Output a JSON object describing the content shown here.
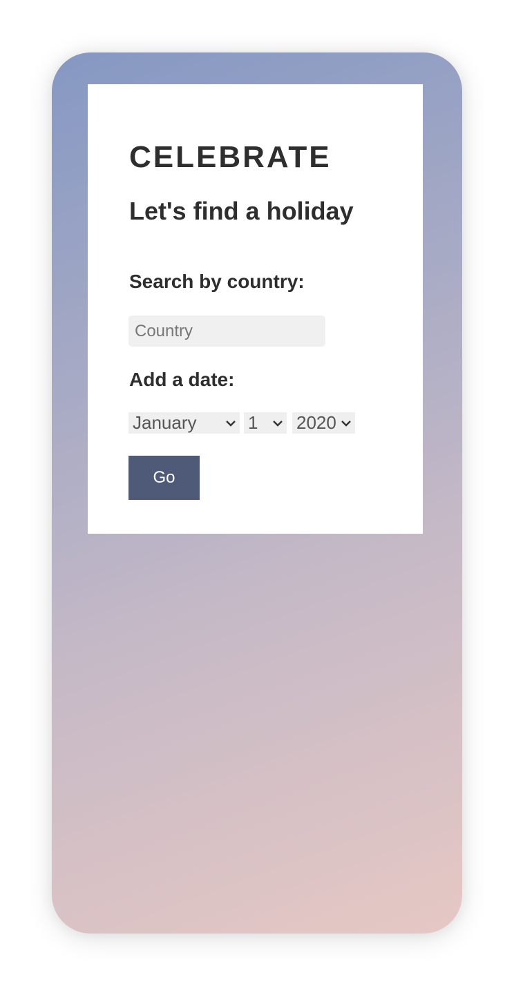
{
  "header": {
    "brand": "CELEBRATE",
    "headline": "Let's find a holiday"
  },
  "search": {
    "label": "Search by country:",
    "placeholder": "Country",
    "value": ""
  },
  "date": {
    "label": "Add a date:",
    "month": "January",
    "day": "1",
    "year": "2020"
  },
  "actions": {
    "go_label": "Go"
  },
  "colors": {
    "button": "#4f5a78",
    "text": "#2e2e2e",
    "gradient_start": "#8598c3",
    "gradient_end": "#e6c8c4"
  },
  "icons": {
    "select_chevron": "chevron-down-icon"
  }
}
